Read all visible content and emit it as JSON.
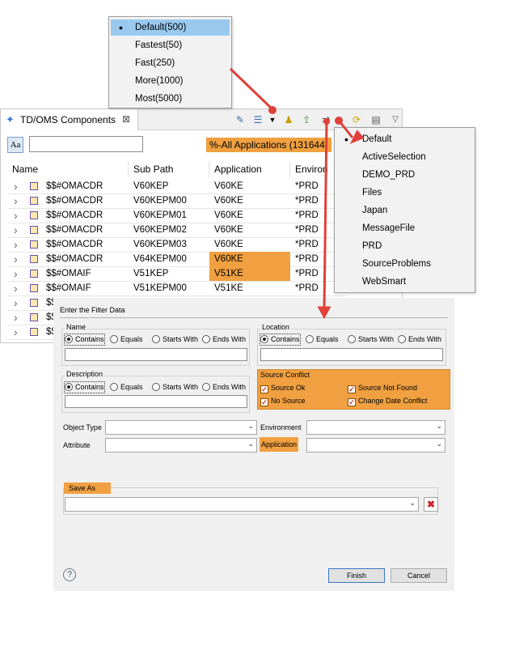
{
  "speed_menu": {
    "items": [
      {
        "label": "Default(500)",
        "selected": true
      },
      {
        "label": "Fastest(50)",
        "selected": false
      },
      {
        "label": "Fast(250)",
        "selected": false
      },
      {
        "label": "More(1000)",
        "selected": false
      },
      {
        "label": "Most(5000)",
        "selected": false
      }
    ]
  },
  "filter_menu": {
    "items": [
      {
        "label": "Default",
        "selected": true
      },
      {
        "label": "ActiveSelection",
        "selected": false
      },
      {
        "label": "DEMO_PRD",
        "selected": false
      },
      {
        "label": "Files",
        "selected": false
      },
      {
        "label": "Japan",
        "selected": false
      },
      {
        "label": "MessageFile",
        "selected": false
      },
      {
        "label": "PRD",
        "selected": false
      },
      {
        "label": "SourceProblems",
        "selected": false
      },
      {
        "label": "WebSmart",
        "selected": false
      }
    ]
  },
  "view": {
    "tab_title": "TD/OMS Components",
    "tab_close": "⊠",
    "case_toggle": "Aa",
    "search_value": "",
    "filter_badge": "%-All Applications (131644)",
    "columns": [
      "Name",
      "Sub Path",
      "Application",
      "Environ"
    ],
    "rows": [
      {
        "name": "$$#OMACDR",
        "subpath": "V60KEP",
        "app": "V60KE",
        "env": "*PRD",
        "hl": false
      },
      {
        "name": "$$#OMACDR",
        "subpath": "V60KEPM00",
        "app": "V60KE",
        "env": "*PRD",
        "hl": false
      },
      {
        "name": "$$#OMACDR",
        "subpath": "V60KEPM01",
        "app": "V60KE",
        "env": "*PRD",
        "hl": false
      },
      {
        "name": "$$#OMACDR",
        "subpath": "V60KEPM02",
        "app": "V60KE",
        "env": "*PRD",
        "hl": false
      },
      {
        "name": "$$#OMACDR",
        "subpath": "V60KEPM03",
        "app": "V60KE",
        "env": "*PRD",
        "hl": false
      },
      {
        "name": "$$#OMACDR",
        "subpath": "V64KEPM00",
        "app": "V60KE",
        "env": "*PRD",
        "hl": true
      },
      {
        "name": "$$#OMAIF",
        "subpath": "V51KEP",
        "app": "V51KE",
        "env": "*PRD",
        "hl": true
      },
      {
        "name": "$$#OMAIF",
        "subpath": "V51KEPM00",
        "app": "V51KE",
        "env": "*PRD",
        "hl": false
      },
      {
        "name": "$$",
        "subpath": "",
        "app": "",
        "env": "",
        "hl": false
      },
      {
        "name": "$$",
        "subpath": "",
        "app": "",
        "env": "",
        "hl": false
      },
      {
        "name": "$$",
        "subpath": "",
        "app": "",
        "env": "",
        "hl": false
      }
    ]
  },
  "dialog": {
    "title": "Enter the Filter Data",
    "name_group": {
      "title": "Name",
      "options": [
        "Contains",
        "Equals",
        "Starts With",
        "Ends With"
      ],
      "selected": 0,
      "value": ""
    },
    "location_group": {
      "title": "Location",
      "options": [
        "Contains",
        "Equals",
        "Starts With",
        "Ends With"
      ],
      "selected": 0,
      "value": ""
    },
    "description_group": {
      "title": "Description",
      "options": [
        "Contains",
        "Equals",
        "Starts With",
        "Ends With"
      ],
      "selected": 0,
      "value": ""
    },
    "source_conflict": {
      "title": "Source Conflict",
      "checks": [
        {
          "label": "Source Ok",
          "checked": true
        },
        {
          "label": "Source Not Found",
          "checked": true
        },
        {
          "label": "No Source",
          "checked": true
        },
        {
          "label": "Change Date Conflict",
          "checked": true
        }
      ]
    },
    "object_type_label": "Object Type",
    "environment_label": "Environment",
    "attribute_label": "Attribute",
    "application_label": "Application",
    "save_as_label": "Save As",
    "help": "?",
    "finish_label": "Finish",
    "cancel_label": "Cancel"
  },
  "colors": {
    "highlight_orange": "#f0a040",
    "menu_selection": "#99c9ef",
    "arrow_red": "#e0403a"
  }
}
